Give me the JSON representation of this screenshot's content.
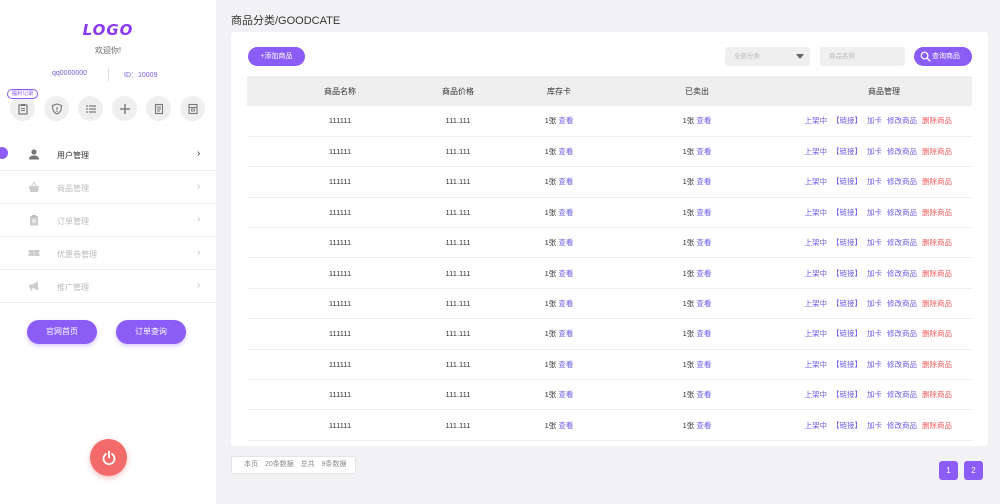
{
  "sidebar": {
    "logo": "LOGO",
    "welcome": "欢迎你!",
    "qq": "qq0000000",
    "uid": "ID：10009",
    "quick_badge": "福利记录",
    "menu": [
      {
        "label": "用户管理",
        "icon": "user-icon",
        "active": true
      },
      {
        "label": "商品管理",
        "icon": "basket-icon",
        "active": false
      },
      {
        "label": "订单管理",
        "icon": "clipboard-icon",
        "active": false
      },
      {
        "label": "优惠卷管理",
        "icon": "ticket-icon",
        "active": false
      },
      {
        "label": "推广管理",
        "icon": "megaphone-icon",
        "active": false
      }
    ],
    "home_btn": "官网首页",
    "order_btn": "订单查询",
    "chevron": "›"
  },
  "main": {
    "breadcrumb": "商品分类/GOODCATE",
    "add_btn": "+添加商品",
    "category_select": "全部分类",
    "search_placeholder": "商品名称",
    "search_btn": "查询商品",
    "headers": [
      "商品名称",
      "商品价格",
      "库存卡",
      "已卖出",
      "商品管理"
    ],
    "rows": [
      {
        "name": "111111",
        "price": "111.111",
        "stock": "1张",
        "sold": "1张"
      },
      {
        "name": "111111",
        "price": "111.111",
        "stock": "1张",
        "sold": "1张"
      },
      {
        "name": "111111",
        "price": "111.111",
        "stock": "1张",
        "sold": "1张"
      },
      {
        "name": "111111",
        "price": "111.111",
        "stock": "1张",
        "sold": "1张"
      },
      {
        "name": "111111",
        "price": "111.111",
        "stock": "1张",
        "sold": "1张"
      },
      {
        "name": "111111",
        "price": "111.111",
        "stock": "1张",
        "sold": "1张"
      },
      {
        "name": "111111",
        "price": "111.111",
        "stock": "1张",
        "sold": "1张"
      },
      {
        "name": "111111",
        "price": "111.111",
        "stock": "1张",
        "sold": "1张"
      },
      {
        "name": "111111",
        "price": "111.111",
        "stock": "1张",
        "sold": "1张"
      },
      {
        "name": "111111",
        "price": "111.111",
        "stock": "1张",
        "sold": "1张"
      },
      {
        "name": "111111",
        "price": "111.111",
        "stock": "1张",
        "sold": "1张"
      }
    ],
    "view_link": "查看",
    "ops": {
      "status": "上架中",
      "link": "【链接】",
      "add_card": "加卡",
      "edit": "修改商品",
      "delete": "删除商品"
    },
    "summary": {
      "page": "本页",
      "page_count": "20条数据",
      "total": "总共",
      "total_count": "9条数据"
    },
    "pages": [
      "1",
      "2"
    ]
  },
  "colors": {
    "accent": "#8b5cf6",
    "danger": "#f25c5c",
    "logo": "#8b38f0",
    "power": "#f36a6a"
  }
}
